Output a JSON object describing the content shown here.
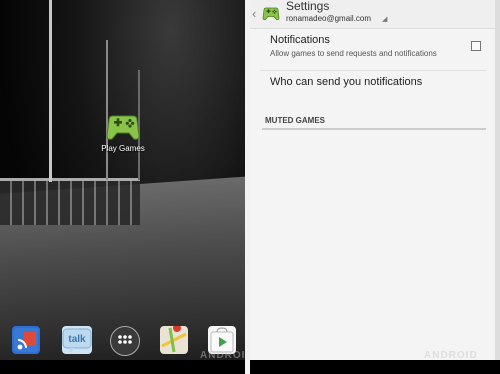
{
  "home": {
    "app_label": "Play Games",
    "dock_items": [
      {
        "icon": "rss-app-icon"
      },
      {
        "icon": "talk-app-icon",
        "label": "talk"
      },
      {
        "icon": "app-drawer-icon"
      },
      {
        "icon": "maps-icon"
      },
      {
        "icon": "play-store-icon"
      }
    ]
  },
  "settings": {
    "title": "Settings",
    "account": "ronamadeo@gmail.com",
    "notifications": {
      "title": "Notifications",
      "subtitle": "Allow games to send requests and notifications"
    },
    "who_can_send": "Who can send you notifications",
    "muted_games_header": "MUTED GAMES"
  },
  "watermark": "ANDROID"
}
